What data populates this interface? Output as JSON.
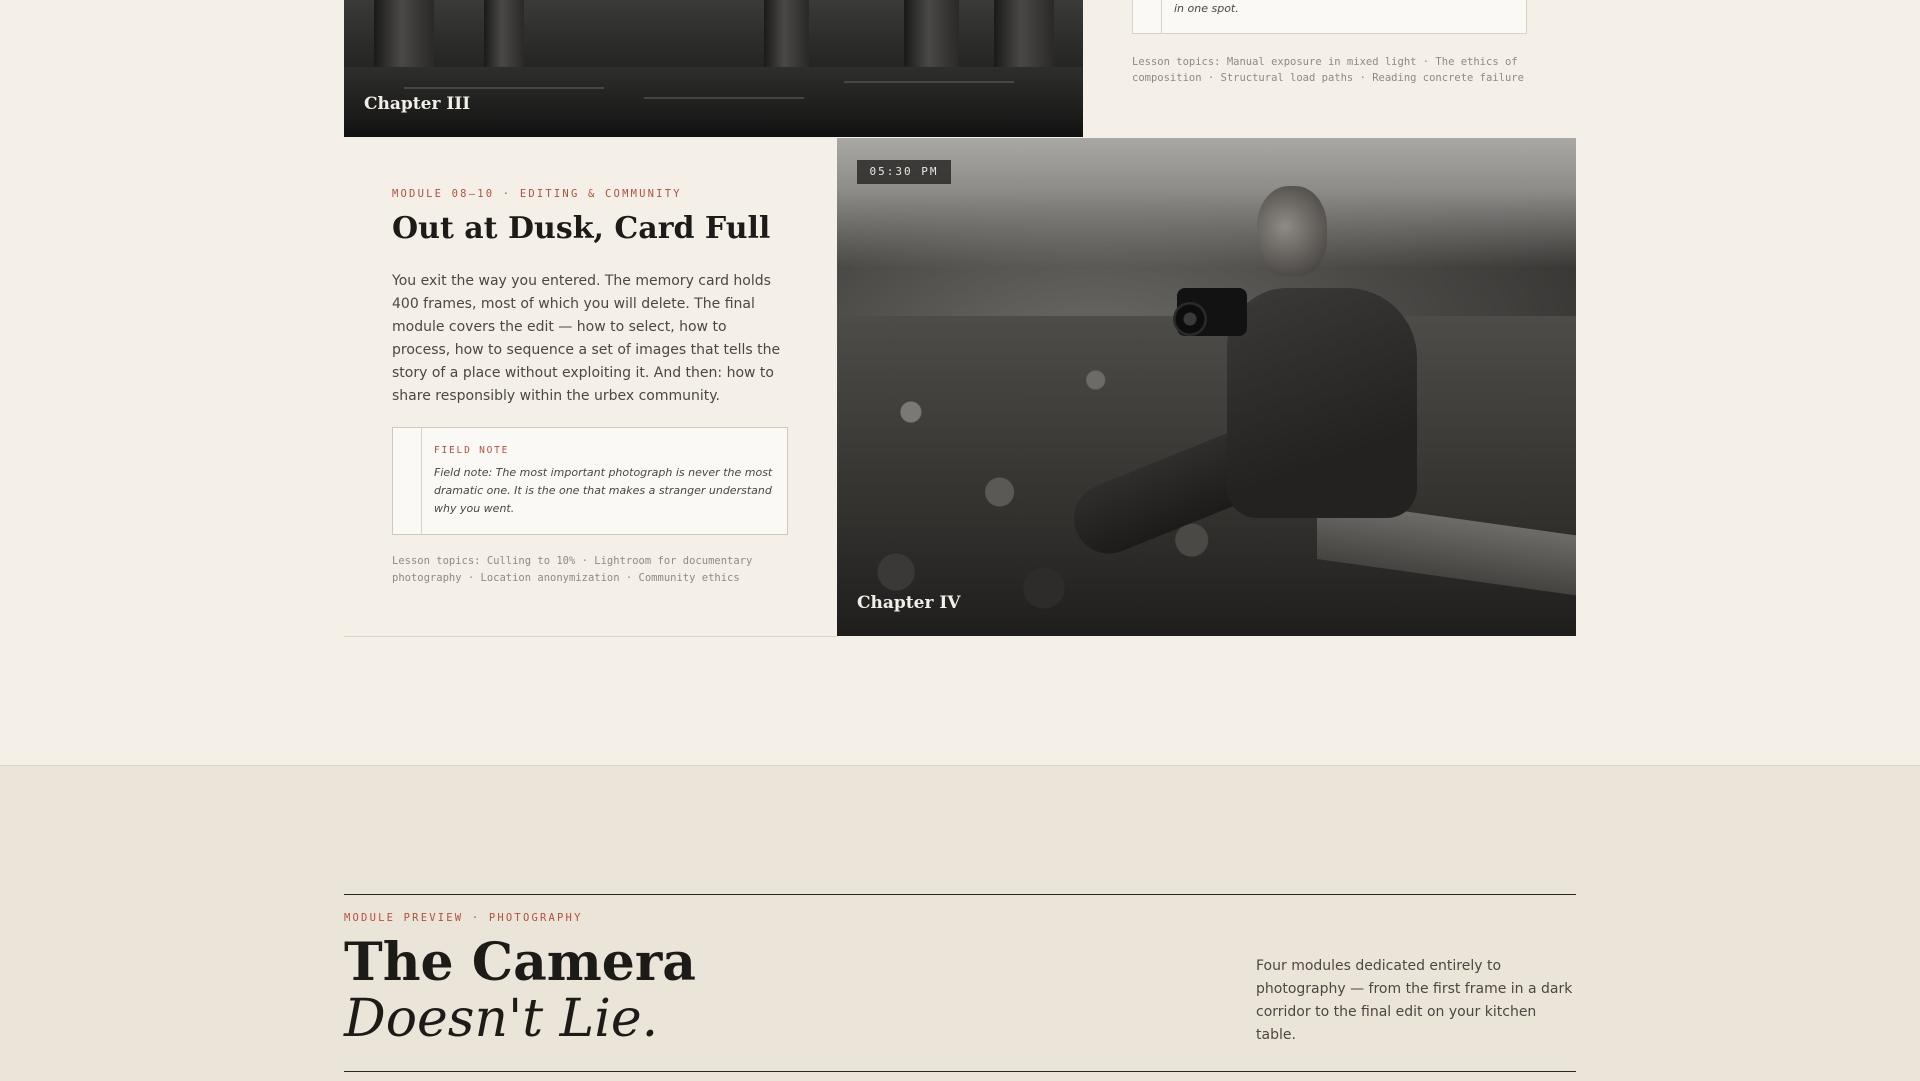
{
  "chapter3": {
    "label": "Chapter III",
    "note_fragment": "in one spot.",
    "topics": "Lesson topics: Manual exposure in mixed light · The ethics of composition · Structural load paths · Reading concrete failure"
  },
  "module": {
    "eyebrow": "MODULE 08–10 · EDITING & COMMUNITY",
    "title": "Out at Dusk, Card Full",
    "body": "You exit the way you entered. The memory card holds 400 frames, most of which you will delete. The final module covers the edit — how to select, how to process, how to sequence a set of images that tells the story of a place without exploiting it. And then: how to share responsibly within the urbex community.",
    "field_note_label": "FIELD NOTE",
    "field_note_text": "Field note: The most important photograph is never the most dramatic one. It is the one that makes a stranger understand why you went.",
    "topics": "Lesson topics: Culling to 10% · Lightroom for documentary photography · Location anonymization · Community ethics"
  },
  "chapter4": {
    "label": "Chapter IV",
    "time": "05:30 PM"
  },
  "preview": {
    "eyebrow": "MODULE PREVIEW · PHOTOGRAPHY",
    "title_line1": "The Camera",
    "title_line2": "Doesn't Lie.",
    "description": "Four modules dedicated entirely to photography — from the first frame in a dark corridor to the final edit on your kitchen table."
  },
  "colors": {
    "background": "#f4f0e8",
    "band": "#ebe5d9",
    "accent": "#b3503e",
    "ink": "#1d1b18"
  }
}
